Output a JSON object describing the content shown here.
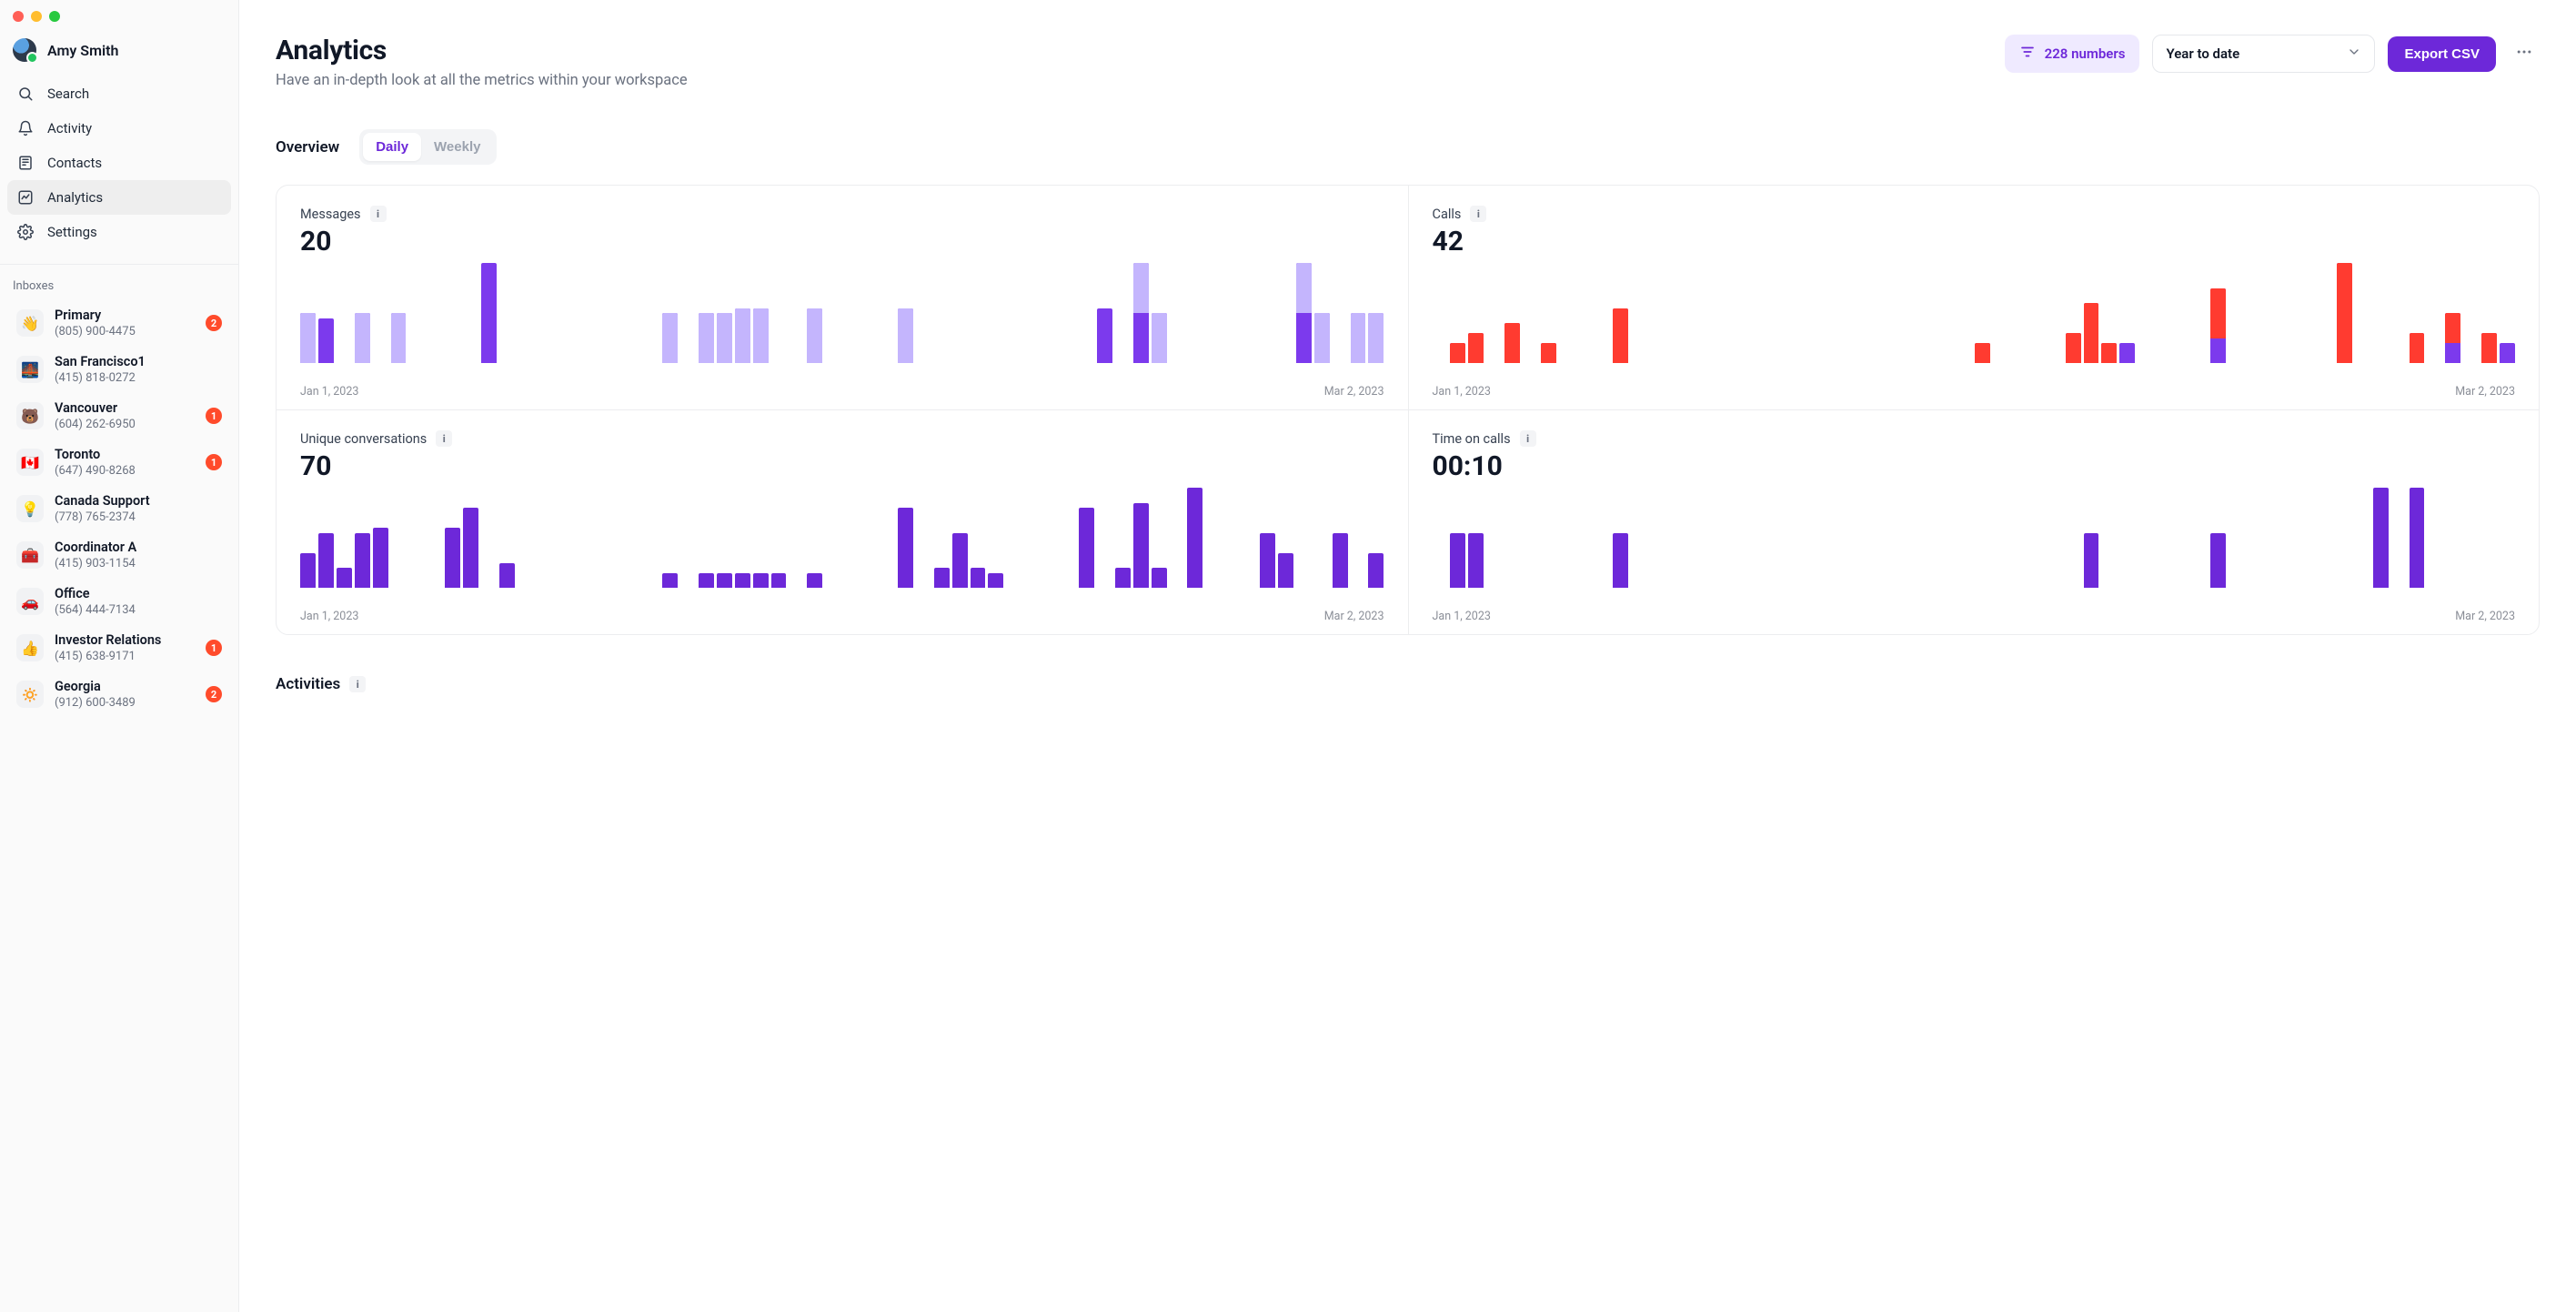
{
  "window": {
    "traffic_lights": [
      "close",
      "min",
      "max"
    ]
  },
  "user": {
    "name": "Amy Smith"
  },
  "sidebar": {
    "items": [
      {
        "label": "Search",
        "icon": "search"
      },
      {
        "label": "Activity",
        "icon": "bell"
      },
      {
        "label": "Contacts",
        "icon": "contacts"
      },
      {
        "label": "Analytics",
        "icon": "analytics",
        "active": true
      },
      {
        "label": "Settings",
        "icon": "gear"
      }
    ],
    "section_label": "Inboxes",
    "inboxes": [
      {
        "emoji": "👋",
        "name": "Primary",
        "phone": "(805) 900-4475",
        "badge": 2
      },
      {
        "emoji": "🌉",
        "name": "San Francisco1",
        "phone": "(415) 818-0272"
      },
      {
        "emoji": "🐻",
        "name": "Vancouver",
        "phone": "(604) 262-6950",
        "badge": 1
      },
      {
        "emoji": "🇨🇦",
        "name": "Toronto",
        "phone": "(647) 490-8268",
        "badge": 1
      },
      {
        "emoji": "💡",
        "name": "Canada Support",
        "phone": "(778) 765-2374"
      },
      {
        "emoji": "🧰",
        "name": "Coordinator A",
        "phone": "(415) 903-1154"
      },
      {
        "emoji": "🚗",
        "name": "Office",
        "phone": "(564) 444-7134"
      },
      {
        "emoji": "👍",
        "name": "Investor Relations",
        "phone": "(415) 638-9171",
        "badge": 1
      },
      {
        "emoji": "🔅",
        "name": "Georgia",
        "phone": "(912) 600-3489",
        "badge": 2
      }
    ]
  },
  "header": {
    "title": "Analytics",
    "subtitle": "Have an in-depth look at all the metrics within your workspace",
    "filter_label": "228 numbers",
    "range_label": "Year to date",
    "export_label": "Export CSV"
  },
  "tabs": {
    "overview_label": "Overview",
    "daily_label": "Daily",
    "weekly_label": "Weekly",
    "active": "Daily"
  },
  "activities": {
    "label": "Activities"
  },
  "chart_data": [
    {
      "id": "messages",
      "title": "Messages",
      "type": "bar-stacked",
      "value_label": "20",
      "xlabel_start": "Jan 1, 2023",
      "xlabel_end": "Mar 2, 2023",
      "colors": {
        "primary": "#7c3aed",
        "secondary": "#c4b5fd"
      },
      "ylim": [
        0,
        100
      ],
      "series_names": [
        "primary",
        "secondary"
      ],
      "values": [
        [
          0,
          50
        ],
        [
          45,
          0
        ],
        [
          0,
          0
        ],
        [
          0,
          50
        ],
        [
          0,
          0
        ],
        [
          0,
          50
        ],
        [
          0,
          0
        ],
        [
          0,
          0
        ],
        [
          0,
          0
        ],
        [
          0,
          0
        ],
        [
          100,
          0
        ],
        [
          0,
          0
        ],
        [
          0,
          0
        ],
        [
          0,
          0
        ],
        [
          0,
          0
        ],
        [
          0,
          0
        ],
        [
          0,
          0
        ],
        [
          0,
          0
        ],
        [
          0,
          0
        ],
        [
          0,
          0
        ],
        [
          0,
          50
        ],
        [
          0,
          0
        ],
        [
          0,
          50
        ],
        [
          0,
          50
        ],
        [
          0,
          55
        ],
        [
          0,
          55
        ],
        [
          0,
          0
        ],
        [
          0,
          0
        ],
        [
          0,
          55
        ],
        [
          0,
          0
        ],
        [
          0,
          0
        ],
        [
          0,
          0
        ],
        [
          0,
          0
        ],
        [
          0,
          55
        ],
        [
          0,
          0
        ],
        [
          0,
          0
        ],
        [
          0,
          0
        ],
        [
          0,
          0
        ],
        [
          0,
          0
        ],
        [
          0,
          0
        ],
        [
          0,
          0
        ],
        [
          0,
          0
        ],
        [
          0,
          0
        ],
        [
          0,
          0
        ],
        [
          55,
          0
        ],
        [
          0,
          0
        ],
        [
          50,
          50
        ],
        [
          0,
          50
        ],
        [
          0,
          0
        ],
        [
          0,
          0
        ],
        [
          0,
          0
        ],
        [
          0,
          0
        ],
        [
          0,
          0
        ],
        [
          0,
          0
        ],
        [
          0,
          0
        ],
        [
          50,
          50
        ],
        [
          0,
          50
        ],
        [
          0,
          0
        ],
        [
          0,
          50
        ],
        [
          0,
          50
        ]
      ]
    },
    {
      "id": "calls",
      "title": "Calls",
      "type": "bar-stacked",
      "value_label": "42",
      "xlabel_start": "Jan 1, 2023",
      "xlabel_end": "Mar 2, 2023",
      "colors": {
        "primary": "#7c3aed",
        "secondary": "#ff3b30"
      },
      "ylim": [
        0,
        100
      ],
      "series_names": [
        "primary",
        "secondary"
      ],
      "values": [
        [
          0,
          0
        ],
        [
          0,
          20
        ],
        [
          0,
          30
        ],
        [
          0,
          0
        ],
        [
          0,
          40
        ],
        [
          0,
          0
        ],
        [
          0,
          20
        ],
        [
          0,
          0
        ],
        [
          0,
          0
        ],
        [
          0,
          0
        ],
        [
          0,
          55
        ],
        [
          0,
          0
        ],
        [
          0,
          0
        ],
        [
          0,
          0
        ],
        [
          0,
          0
        ],
        [
          0,
          0
        ],
        [
          0,
          0
        ],
        [
          0,
          0
        ],
        [
          0,
          0
        ],
        [
          0,
          0
        ],
        [
          0,
          0
        ],
        [
          0,
          0
        ],
        [
          0,
          0
        ],
        [
          0,
          0
        ],
        [
          0,
          0
        ],
        [
          0,
          0
        ],
        [
          0,
          0
        ],
        [
          0,
          0
        ],
        [
          0,
          0
        ],
        [
          0,
          0
        ],
        [
          0,
          20
        ],
        [
          0,
          0
        ],
        [
          0,
          0
        ],
        [
          0,
          0
        ],
        [
          0,
          0
        ],
        [
          0,
          30
        ],
        [
          0,
          60
        ],
        [
          0,
          20
        ],
        [
          20,
          0
        ],
        [
          0,
          0
        ],
        [
          0,
          0
        ],
        [
          0,
          0
        ],
        [
          0,
          0
        ],
        [
          25,
          50
        ],
        [
          0,
          0
        ],
        [
          0,
          0
        ],
        [
          0,
          0
        ],
        [
          0,
          0
        ],
        [
          0,
          0
        ],
        [
          0,
          0
        ],
        [
          0,
          100
        ],
        [
          0,
          0
        ],
        [
          0,
          0
        ],
        [
          0,
          0
        ],
        [
          0,
          30
        ],
        [
          0,
          0
        ],
        [
          20,
          30
        ],
        [
          0,
          0
        ],
        [
          0,
          30
        ],
        [
          20,
          0
        ]
      ]
    },
    {
      "id": "unique_conversations",
      "title": "Unique conversations",
      "type": "bar",
      "value_label": "70",
      "xlabel_start": "Jan 1, 2023",
      "xlabel_end": "Mar 2, 2023",
      "colors": {
        "primary": "#6d28d9"
      },
      "ylim": [
        0,
        100
      ],
      "values": [
        35,
        55,
        20,
        55,
        60,
        0,
        0,
        0,
        60,
        80,
        0,
        25,
        0,
        0,
        0,
        0,
        0,
        0,
        0,
        0,
        15,
        0,
        15,
        15,
        15,
        15,
        15,
        0,
        15,
        0,
        0,
        0,
        0,
        80,
        0,
        20,
        55,
        20,
        15,
        0,
        0,
        0,
        0,
        80,
        0,
        20,
        85,
        20,
        0,
        100,
        0,
        0,
        0,
        55,
        35,
        0,
        0,
        55,
        0,
        35
      ]
    },
    {
      "id": "time_on_calls",
      "title": "Time on calls",
      "type": "bar",
      "value_label": "00:10",
      "xlabel_start": "Jan 1, 2023",
      "xlabel_end": "Mar 2, 2023",
      "colors": {
        "primary": "#6d28d9"
      },
      "ylim": [
        0,
        100
      ],
      "values": [
        0,
        55,
        55,
        0,
        0,
        0,
        0,
        0,
        0,
        0,
        55,
        0,
        0,
        0,
        0,
        0,
        0,
        0,
        0,
        0,
        0,
        0,
        0,
        0,
        0,
        0,
        0,
        0,
        0,
        0,
        0,
        0,
        0,
        0,
        0,
        0,
        55,
        0,
        0,
        0,
        0,
        0,
        0,
        55,
        0,
        0,
        0,
        0,
        0,
        0,
        0,
        0,
        100,
        0,
        100,
        0,
        0,
        0,
        0,
        0
      ]
    }
  ]
}
